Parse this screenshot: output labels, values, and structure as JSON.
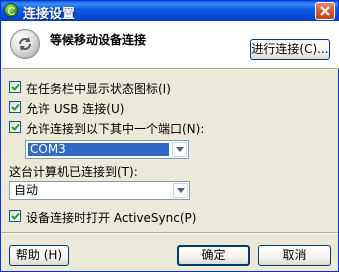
{
  "window": {
    "title": "连接设置",
    "close_icon": "close-icon",
    "app_icon": "activesync-icon"
  },
  "header": {
    "icon": "sync-icon",
    "title": "等候移动设备连接",
    "connect_button_label": "进行连接(C)..."
  },
  "options": {
    "show_tray_icon": {
      "label": "在任务栏中显示状态图标(I)",
      "checked": true
    },
    "allow_usb": {
      "label": "允许 USB 连接(U)",
      "checked": true
    },
    "allow_port": {
      "label": "允许连接到以下其中一个端口(N):",
      "checked": true
    },
    "port_value": "COM3",
    "connected_to_label": "这台计算机已连接到(T):",
    "connected_to_value": "自动",
    "open_activesync": {
      "label": "设备连接时打开 ActiveSync(P)",
      "checked": true
    }
  },
  "footer": {
    "help_label": "帮助 (H)",
    "ok_label": "确定",
    "cancel_label": "取消"
  },
  "colors": {
    "titlebar": "#0a5fe6",
    "dialog_bg": "#ece9d8",
    "selection": "#316ac5",
    "close_button": "#d55a35"
  }
}
